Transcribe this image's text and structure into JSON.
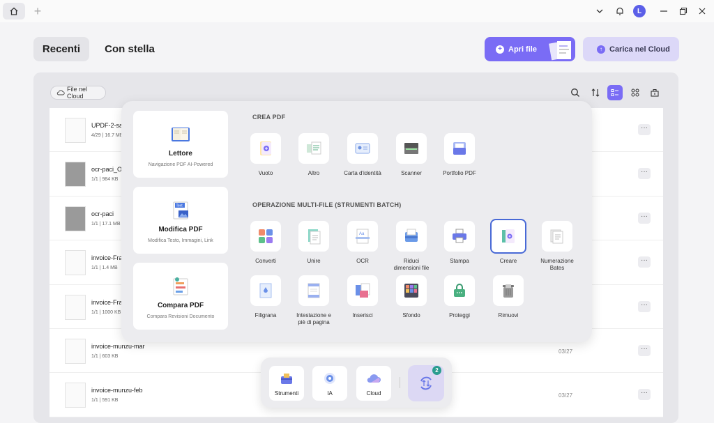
{
  "titlebar": {
    "avatar_letter": "L"
  },
  "header": {
    "tabs": [
      {
        "label": "Recenti"
      },
      {
        "label": "Con stella"
      }
    ],
    "open_label": "Apri file",
    "cloud_label": "Carica nel Cloud"
  },
  "panel": {
    "chip_label": "File nel Cloud"
  },
  "files": [
    {
      "name": "UPDF-2-sa",
      "meta": "4/29 | 16.7 MB",
      "date": ""
    },
    {
      "name": "ocr-paci_O",
      "meta": "1/1 | 984 KB",
      "date": ""
    },
    {
      "name": "ocr-paci",
      "meta": "1/1 | 17.1 MB",
      "date": ""
    },
    {
      "name": "invoice-Fra",
      "meta": "1/1 | 1.4 MB",
      "date": ""
    },
    {
      "name": "invoice-Fra",
      "meta": "1/1 | 1000 KB",
      "date": ""
    },
    {
      "name": "invoice-munzu-mar",
      "meta": "1/1 | 603 KB",
      "date": "03/27"
    },
    {
      "name": "invoice-munzu-feb",
      "meta": "1/1 | 591 KB",
      "date": "03/27"
    }
  ],
  "popup": {
    "cards": [
      {
        "title": "Lettore",
        "subtitle": "Navigazione PDF AI-Powered"
      },
      {
        "title": "Modifica PDF",
        "subtitle": "Modifica Testo, Immagini, Link",
        "icon_text": "Text"
      },
      {
        "title": "Compara PDF",
        "subtitle": "Compara Revisioni Documento"
      }
    ],
    "section_create": "CREA PDF",
    "create_tools": [
      "Vuoto",
      "Altro",
      "Carta d'identità",
      "Scanner",
      "Portfolio PDF"
    ],
    "section_batch": "OPERAZIONE MULTI-FILE (STRUMENTI BATCH)",
    "batch_row1": [
      "Converti",
      "Unire",
      "OCR",
      "Riduci dimensioni file",
      "Stampa",
      "Creare",
      "Numerazione Bates"
    ],
    "batch_row2": [
      "Filigrana",
      "Intestazione e piè di pagina",
      "Inserisci",
      "Sfondo",
      "Proteggi",
      "Rimuovi"
    ],
    "ocr_icon_text": "Aa"
  },
  "dock": {
    "items": [
      {
        "label": "Strumenti"
      },
      {
        "label": "IA"
      },
      {
        "label": "Cloud"
      }
    ],
    "badge": "2"
  },
  "colors": {
    "accent": "#7a6cf5",
    "selection": "#4869d6"
  }
}
